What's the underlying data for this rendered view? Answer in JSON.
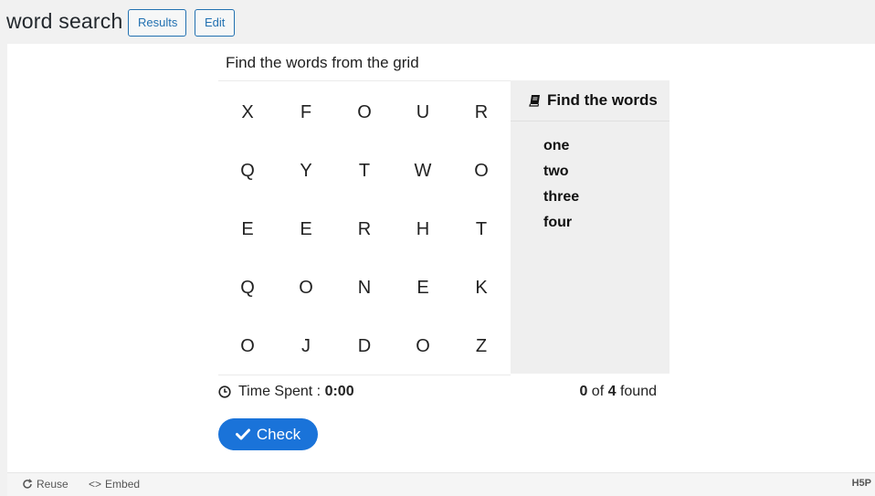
{
  "header": {
    "title": "word search",
    "results_label": "Results",
    "edit_label": "Edit"
  },
  "puzzle": {
    "instruction": "Find the words from the grid",
    "grid": [
      [
        "X",
        "F",
        "O",
        "U",
        "R"
      ],
      [
        "Q",
        "Y",
        "T",
        "W",
        "O"
      ],
      [
        "E",
        "E",
        "R",
        "H",
        "T"
      ],
      [
        "Q",
        "O",
        "N",
        "E",
        "K"
      ],
      [
        "O",
        "J",
        "D",
        "O",
        "Z"
      ]
    ],
    "words_heading": "Find the words",
    "words": [
      "one",
      "two",
      "three",
      "four"
    ],
    "time_label": "Time Spent :",
    "time_value": "0:00",
    "found_count": "0",
    "found_of": "of",
    "total_count": "4",
    "found_suffix": "found",
    "check_label": "Check"
  },
  "footer": {
    "reuse_label": "Reuse",
    "embed_label": "Embed",
    "logo_text": "H5P"
  },
  "icons": {
    "book": "book-icon",
    "clock": "clock-icon",
    "check": "checkmark-icon",
    "reuse": "refresh-icon",
    "embed": "code-icon"
  },
  "colors": {
    "accent": "#1a73d9",
    "link": "#2271b1",
    "panel": "#efefef"
  }
}
